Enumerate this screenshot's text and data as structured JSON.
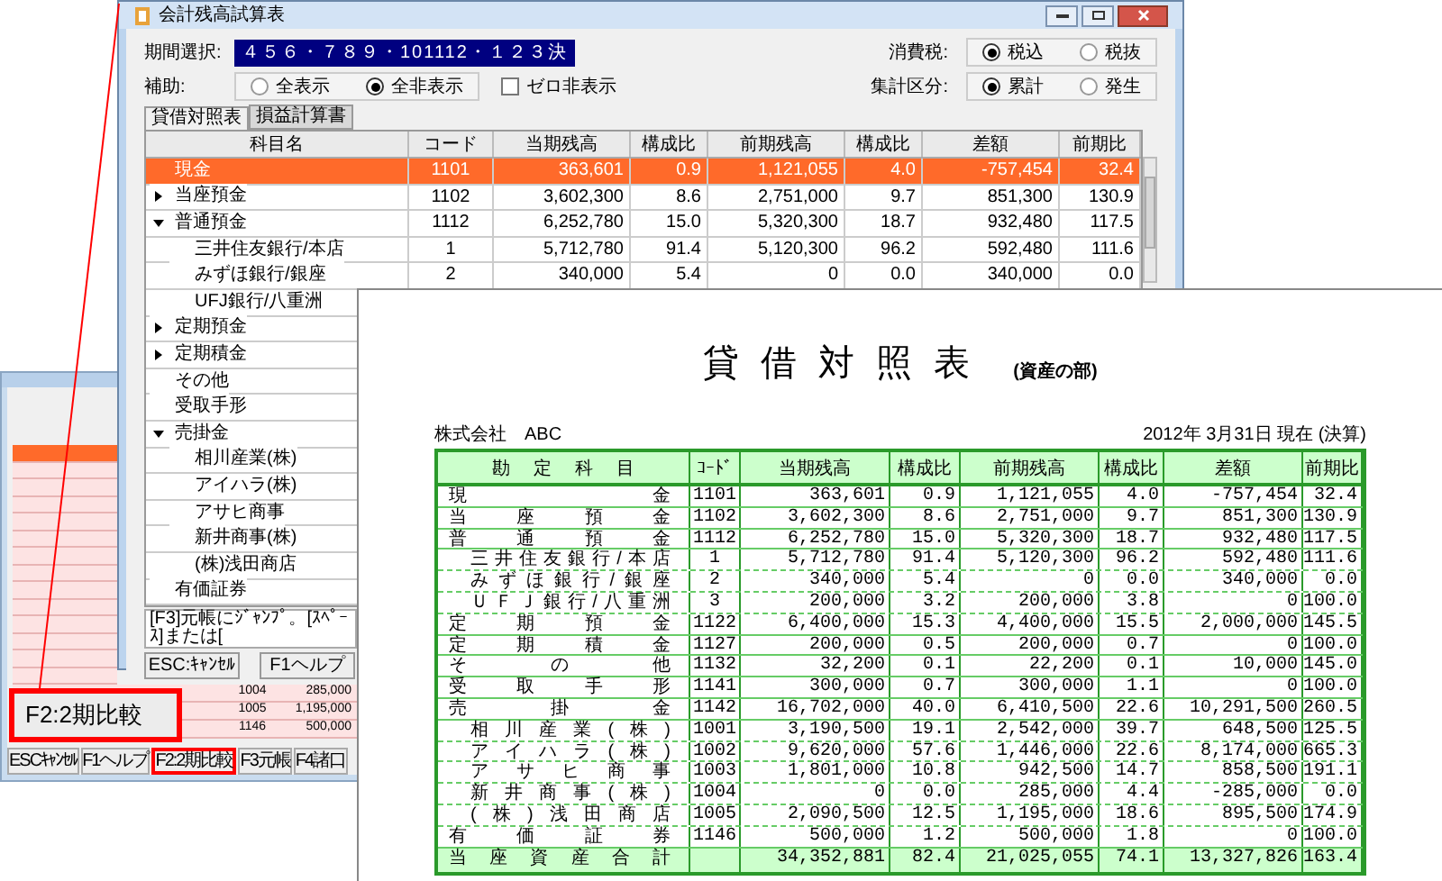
{
  "back_window": {
    "rows": [
      {
        "code": "1004",
        "amount": "285,000"
      },
      {
        "code": "1005",
        "amount": "1,195,000"
      },
      {
        "code": "1146",
        "amount": "500,000"
      }
    ],
    "buttons": [
      {
        "label": "ESCｷｬﾝｾﾙ",
        "highlighted": false
      },
      {
        "label": "F1ヘルプ",
        "highlighted": false
      },
      {
        "label": "F2:2期比較",
        "highlighted": true
      },
      {
        "label": "F3元帳",
        "highlighted": false
      },
      {
        "label": "F4諸口",
        "highlighted": false
      }
    ]
  },
  "callout": {
    "label": "F2:2期比較"
  },
  "window": {
    "title": "会計残高試算表"
  },
  "period": {
    "label": "期間選択:",
    "value": "４５６・７８９・101112・１２３決"
  },
  "tax": {
    "label": "消費税:",
    "options": [
      {
        "label": "税込",
        "selected": true
      },
      {
        "label": "税抜",
        "selected": false
      }
    ]
  },
  "aux": {
    "label": "補助:",
    "options": [
      {
        "label": "全表示",
        "selected": false
      },
      {
        "label": "全非表示",
        "selected": true
      }
    ],
    "zero_hide": {
      "label": "ゼロ非表示",
      "checked": false
    }
  },
  "aggregate": {
    "label": "集計区分:",
    "options": [
      {
        "label": "累計",
        "selected": true
      },
      {
        "label": "発生",
        "selected": false
      }
    ]
  },
  "tabs": [
    {
      "label": "貸借対照表",
      "selected": true
    },
    {
      "label": "損益計算書",
      "selected": false
    }
  ],
  "table": {
    "columns": [
      "科目名",
      "コード",
      "当期残高",
      "構成比",
      "前期残高",
      "構成比",
      "差額",
      "前期比"
    ],
    "rows": [
      {
        "name": "現金",
        "selected": true,
        "cells": [
          "1101",
          "363,601",
          "0.9",
          "1,121,055",
          "4.0",
          "-757,454",
          "32.4"
        ]
      },
      {
        "name": "当座預金",
        "selected": false,
        "expanded": false,
        "cells": [
          "1102",
          "3,602,300",
          "8.6",
          "2,751,000",
          "9.7",
          "851,300",
          "130.9"
        ]
      },
      {
        "name": "普通預金",
        "selected": false,
        "expanded": true,
        "cells": [
          "1112",
          "6,252,780",
          "15.0",
          "5,320,300",
          "18.7",
          "932,480",
          "117.5"
        ],
        "children": [
          {
            "name": "三井住友銀行/本店",
            "selected": false,
            "cells": [
              "1",
              "5,712,780",
              "91.4",
              "5,120,300",
              "96.2",
              "592,480",
              "111.6"
            ]
          },
          {
            "name": "みずほ銀行/銀座",
            "selected": false,
            "cells": [
              "2",
              "340,000",
              "5.4",
              "0",
              "0.0",
              "340,000",
              "0.0"
            ]
          },
          {
            "name": "UFJ銀行/八重洲",
            "selected": false
          }
        ]
      },
      {
        "name": "定期預金",
        "selected": false,
        "expanded": false
      },
      {
        "name": "定期積金",
        "selected": false,
        "expanded": false
      },
      {
        "name": "その他",
        "selected": false
      },
      {
        "name": "受取手形",
        "selected": false
      },
      {
        "name": "売掛金",
        "selected": false,
        "expanded": true,
        "children": [
          {
            "name": "相川産業(株)",
            "selected": false
          },
          {
            "name": "アイハラ(株)",
            "selected": false
          },
          {
            "name": "アサヒ商事",
            "selected": false
          },
          {
            "name": "新井商事(株)",
            "selected": false
          },
          {
            "name": "(株)浅田商店",
            "selected": false
          }
        ]
      },
      {
        "name": "有価証券",
        "selected": false
      }
    ]
  },
  "status_bar": "[F3]元帳にｼﾞｬﾝﾌﾟ。[ｽﾍﾟｰｽ]または[",
  "buttons": [
    "ESC:ｷｬﾝｾﾙ",
    "F1ヘルプ"
  ],
  "report": {
    "title": "貸借対照表",
    "subtitle": "(資産の部)",
    "company": "株式会社　ABC",
    "date": "2012年 3月31日 現在 (決算)",
    "name_header": "勘定科目",
    "columns": [
      "ｺｰﾄﾞ",
      "当期残高",
      "構成比",
      "前期残高",
      "構成比",
      "差額",
      "前期比"
    ],
    "rows": [
      {
        "name": "現金",
        "cells": [
          "1101",
          "363,601",
          "0.9",
          "1,121,055",
          "4.0",
          "-757,454",
          "32.4"
        ]
      },
      {
        "name": "当座預金",
        "cells": [
          "1102",
          "3,602,300",
          "8.6",
          "2,751,000",
          "9.7",
          "851,300",
          "130.9"
        ]
      },
      {
        "name": "普通預金",
        "cells": [
          "1112",
          "6,252,780",
          "15.0",
          "5,320,300",
          "18.7",
          "932,480",
          "117.5"
        ],
        "children": [
          {
            "name": "三井住友銀行/本店",
            "cells": [
              "1",
              "5,712,780",
              "91.4",
              "5,120,300",
              "96.2",
              "592,480",
              "111.6"
            ]
          },
          {
            "name": "みずほ銀行/銀座",
            "cells": [
              "2",
              "340,000",
              "5.4",
              "0",
              "0.0",
              "340,000",
              "0.0"
            ]
          },
          {
            "name": "ＵＦＪ銀行/八重洲",
            "cells": [
              "3",
              "200,000",
              "3.2",
              "200,000",
              "3.8",
              "0",
              "100.0"
            ]
          }
        ]
      },
      {
        "name": "定期預金",
        "cells": [
          "1122",
          "6,400,000",
          "15.3",
          "4,400,000",
          "15.5",
          "2,000,000",
          "145.5"
        ]
      },
      {
        "name": "定期積金",
        "cells": [
          "1127",
          "200,000",
          "0.5",
          "200,000",
          "0.7",
          "0",
          "100.0"
        ]
      },
      {
        "name": "その他",
        "cells": [
          "1132",
          "32,200",
          "0.1",
          "22,200",
          "0.1",
          "10,000",
          "145.0"
        ]
      },
      {
        "name": "受取手形",
        "cells": [
          "1141",
          "300,000",
          "0.7",
          "300,000",
          "1.1",
          "0",
          "100.0"
        ]
      },
      {
        "name": "売掛金",
        "cells": [
          "1142",
          "16,702,000",
          "40.0",
          "6,410,500",
          "22.6",
          "10,291,500",
          "260.5"
        ],
        "children": [
          {
            "name": "相川産業(株)",
            "cells": [
              "1001",
              "3,190,500",
              "19.1",
              "2,542,000",
              "39.7",
              "648,500",
              "125.5"
            ]
          },
          {
            "name": "アイハラ(株)",
            "cells": [
              "1002",
              "9,620,000",
              "57.6",
              "1,446,000",
              "22.6",
              "8,174,000",
              "665.3"
            ]
          },
          {
            "name": "アサヒ商事",
            "cells": [
              "1003",
              "1,801,000",
              "10.8",
              "942,500",
              "14.7",
              "858,500",
              "191.1"
            ]
          },
          {
            "name": "新井商事(株)",
            "cells": [
              "1004",
              "0",
              "0.0",
              "285,000",
              "4.4",
              "-285,000",
              "0.0"
            ]
          },
          {
            "name": "(株)浅田商店",
            "cells": [
              "1005",
              "2,090,500",
              "12.5",
              "1,195,000",
              "18.6",
              "895,500",
              "174.9"
            ]
          }
        ]
      },
      {
        "name": "有価証券",
        "cells": [
          "1146",
          "500,000",
          "1.2",
          "500,000",
          "1.8",
          "0",
          "100.0"
        ]
      }
    ],
    "total": {
      "name": "当座資産合計",
      "cells": [
        "",
        "34,352,881",
        "82.4",
        "21,025,055",
        "74.1",
        "13,327,826",
        "163.4"
      ]
    }
  }
}
